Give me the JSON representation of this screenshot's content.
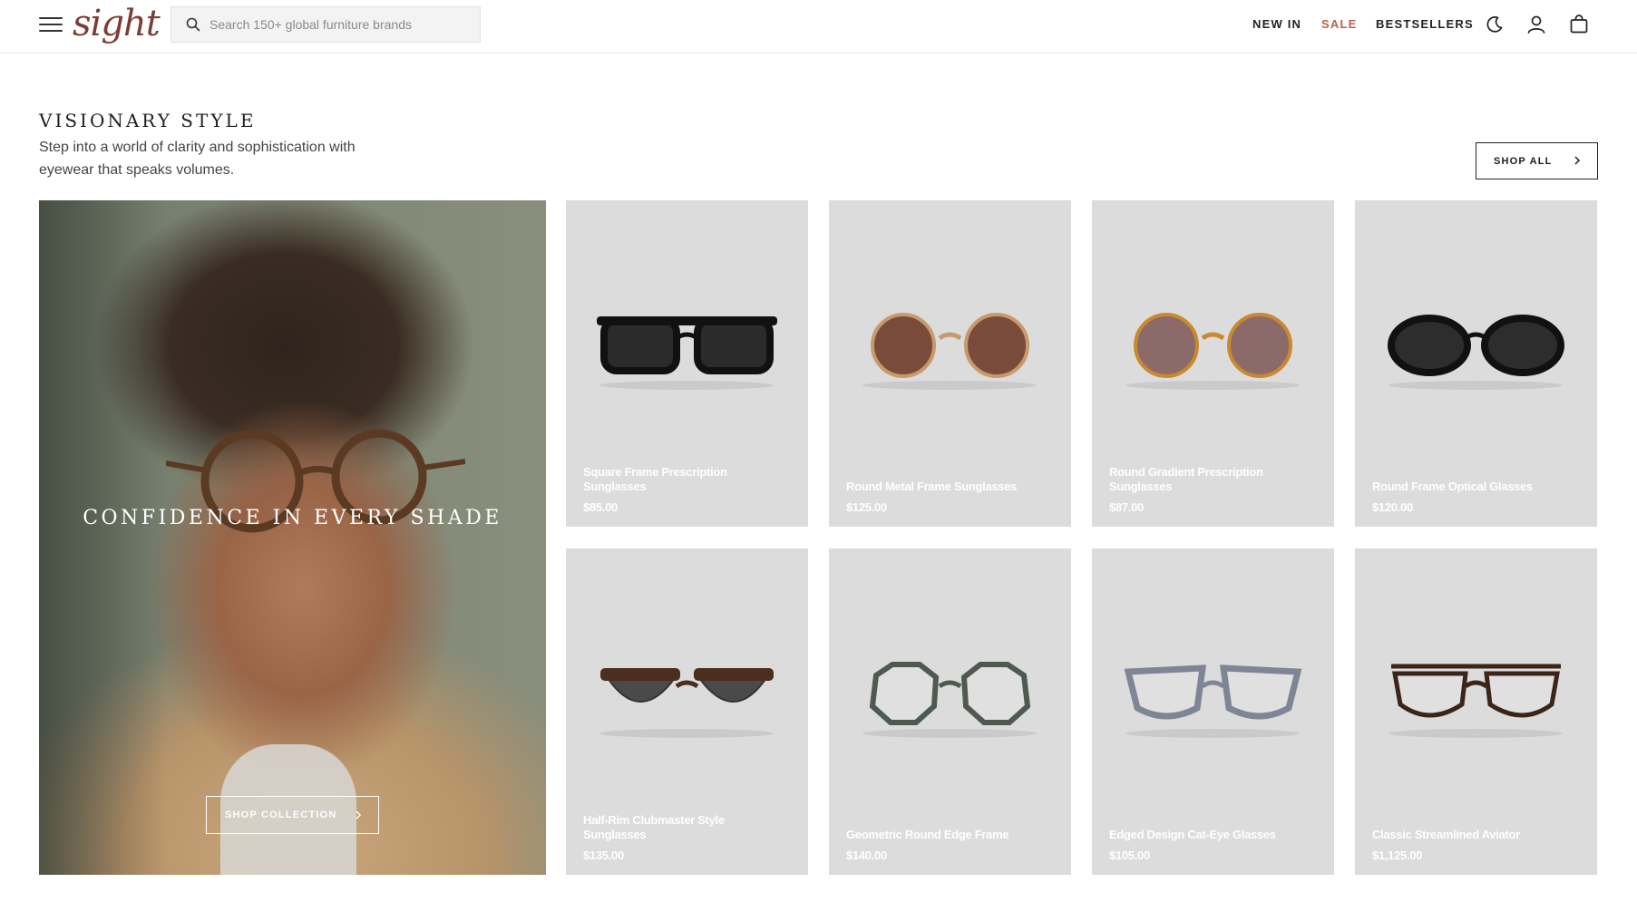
{
  "header": {
    "logo_text": "sight",
    "search_placeholder": "Search 150+ global furniture brands",
    "nav": [
      {
        "label": "NEW IN"
      },
      {
        "label": "SALE",
        "color": "#b7624a"
      },
      {
        "label": "BESTSELLERS"
      }
    ],
    "icons": [
      "moon-icon",
      "user-icon",
      "bag-icon"
    ]
  },
  "section": {
    "title": "VISIONARY STYLE",
    "subtitle": "Step into a world of clarity and sophistication with eyewear that speaks volumes.",
    "shop_all_label": "SHOP ALL"
  },
  "hero": {
    "title": "CONFIDENCE IN EVERY SHADE",
    "button_label": "SHOP COLLECTION"
  },
  "products": [
    {
      "name": "Square Frame Prescription Sunglasses",
      "price": "$85.00",
      "frame_color": "#111111",
      "lens_color": "#2b2b2b",
      "shape": "square"
    },
    {
      "name": "Round Metal Frame Sunglasses",
      "price": "$125.00",
      "frame_color": "#c79a6d",
      "lens_color": "#7a4a3a",
      "shape": "round"
    },
    {
      "name": "Round Gradient Prescription Sunglasses",
      "price": "$87.00",
      "frame_color": "#c98a2e",
      "lens_color": "#8c6a6a",
      "shape": "round"
    },
    {
      "name": "Round Frame Optical Glasses",
      "price": "$120.00",
      "frame_color": "#111111",
      "lens_color": "#2d2d2d",
      "shape": "oval"
    },
    {
      "name": "Half-Rim Clubmaster Style Sunglasses",
      "price": "$135.00",
      "frame_color": "#4a2e1f",
      "lens_color": "#4a4a4a",
      "shape": "club"
    },
    {
      "name": "Geometric Round Edge Frame",
      "price": "$140.00",
      "frame_color": "#4e5a50",
      "lens_color": "none",
      "shape": "geo"
    },
    {
      "name": "Edged Design Cat-Eye Glasses",
      "price": "$105.00",
      "frame_color": "#7e8594",
      "lens_color": "none",
      "shape": "cat"
    },
    {
      "name": "Classic Streamlined Aviator",
      "price": "$1,125.00",
      "frame_color": "#3b2418",
      "lens_color": "none",
      "shape": "aviator"
    }
  ]
}
